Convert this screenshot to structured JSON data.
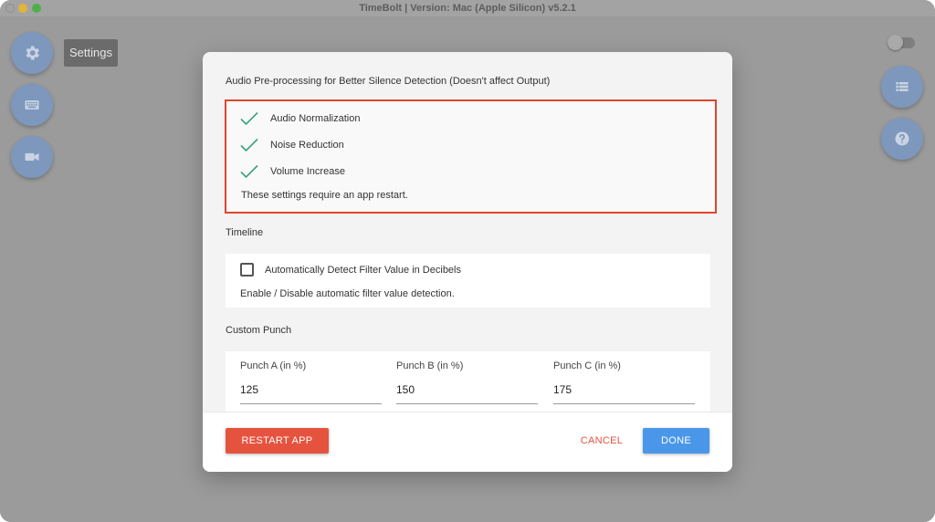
{
  "window": {
    "title": "TimeBolt | Version: Mac (Apple Silicon) v5.2.1"
  },
  "sidebar_left": {
    "tooltip": "Settings",
    "buttons": [
      {
        "icon": "gear-icon"
      },
      {
        "icon": "keyboard-icon"
      },
      {
        "icon": "video-camera-icon"
      }
    ]
  },
  "sidebar_right": {
    "toggle_on": false,
    "buttons": [
      {
        "icon": "list-icon"
      },
      {
        "icon": "help-icon"
      }
    ]
  },
  "dialog": {
    "audio": {
      "title": "Audio Pre-processing for Better Silence Detection (Doesn't affect Output)",
      "options": [
        {
          "label": "Audio Normalization",
          "checked": true
        },
        {
          "label": "Noise Reduction",
          "checked": true
        },
        {
          "label": "Volume Increase",
          "checked": true
        }
      ],
      "note": "These settings require an app restart."
    },
    "timeline": {
      "title": "Timeline",
      "option_label": "Automatically Detect Filter Value in Decibels",
      "checked": false,
      "note": "Enable / Disable automatic filter value detection."
    },
    "punch": {
      "title": "Custom Punch",
      "fields": [
        {
          "label": "Punch A (in %)",
          "value": "125"
        },
        {
          "label": "Punch B (in %)",
          "value": "150"
        },
        {
          "label": "Punch C (in %)",
          "value": "175"
        }
      ]
    },
    "footer": {
      "restart_label": "RESTART APP",
      "cancel_label": "CANCEL",
      "done_label": "DONE"
    }
  },
  "colors": {
    "accent_blue": "#4a97ea",
    "danger_red": "#e5533f",
    "check_green": "#3aa17e",
    "fab_blue": "#7d97bd"
  }
}
